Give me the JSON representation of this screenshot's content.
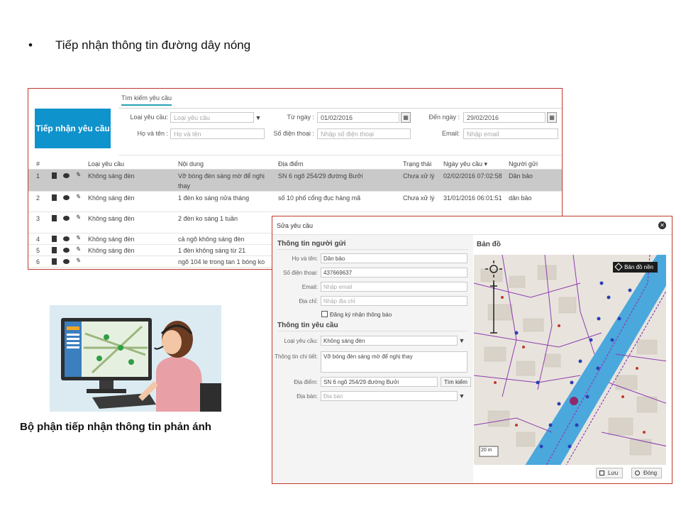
{
  "heading": {
    "bullet": "•",
    "text": "Tiếp nhận thông tin đường dây nóng"
  },
  "list_panel": {
    "tab": "Tìm kiếm yêu cầu",
    "big_button": "Tiếp nhận yêu cầu",
    "filters": {
      "request_type_label": "Loại yêu cầu:",
      "request_type_placeholder": "Loại yêu cầu",
      "from_date_label": "Từ ngày :",
      "from_date_value": "01/02/2016",
      "to_date_label": "Đến ngày :",
      "to_date_value": "29/02/2016",
      "name_label": "Họ và tên :",
      "name_placeholder": "Họ và tên",
      "phone_label": "Số điện thoại :",
      "phone_placeholder": "Nhập số điện thoại",
      "email_label": "Email:",
      "email_placeholder": "Nhập email"
    },
    "columns": [
      "#",
      "Loại yêu cầu",
      "Nội dung",
      "Địa điểm",
      "Trạng thái",
      "Ngày yêu cầu ▾",
      "Người gửi"
    ],
    "rows": [
      {
        "num": "1",
        "type": "Không sáng đèn",
        "content": "Vỡ bóng đèn sáng mờ để nghị",
        "content2": "thay",
        "place": "SN 6 ngõ 254/29 đường Bưởi",
        "status": "Chưa xử lý",
        "date": "02/02/2016 07:02:58",
        "sender": "Dân bảo"
      },
      {
        "num": "2",
        "type": "Không sáng đèn",
        "content": "1 đèn ko sáng nửa tháng",
        "content2": "",
        "place": "số 10 phố cổng đục hàng mã",
        "status": "Chưa xử lý",
        "date": "31/01/2016 06:01:51",
        "sender": "dân bảo"
      },
      {
        "num": "3",
        "type": "Không sáng đèn",
        "content": "2 đèn ko sáng 1 tuần",
        "content2": "",
        "place": "",
        "status": "",
        "date": "",
        "sender": ""
      },
      {
        "num": "4",
        "type": "Không sáng đèn",
        "content": "cả ngõ không sáng đèn",
        "content2": "",
        "place": "",
        "status": "",
        "date": "",
        "sender": ""
      },
      {
        "num": "5",
        "type": "Không sáng đèn",
        "content": "1 đèn không sáng từ 21",
        "content2": "",
        "place": "",
        "status": "",
        "date": "",
        "sender": ""
      },
      {
        "num": "6",
        "type": "",
        "content": "ngõ 104 le trong tan 1 bóng ko",
        "content2": "",
        "place": "",
        "status": "",
        "date": "",
        "sender": ""
      }
    ]
  },
  "caption": "Bộ phận tiếp nhận thông tin phản ánh",
  "edit_dialog": {
    "title": "Sửa yêu cầu",
    "sender_section": "Thông tin người gửi",
    "name_label": "Họ và tên:",
    "name_value": "Dân bảo",
    "phone_label": "Số điện thoại:",
    "phone_value": "437669637",
    "email_label": "Email:",
    "email_placeholder": "Nhập email",
    "address_label": "Địa chỉ:",
    "address_placeholder": "Nhập địa chỉ",
    "notify_label": "Đăng ký nhận thông báo",
    "request_section": "Thông tin yêu cầu",
    "type_label": "Loại yêu cầu:",
    "type_value": "Không sáng đèn",
    "detail_label": "Thông tin chi tiết:",
    "detail_value": "Vỡ bóng đèn sáng mờ để nghị thay",
    "place_label": "Địa điểm:",
    "place_value": "SN 6 ngõ 254/29 đường Bưởi",
    "search_button": "Tìm kiếm",
    "area_label": "Địa bàn:",
    "area_placeholder": "Địa bàn",
    "map_title": "Bản đồ",
    "basemap_button": "Bản đồ nền",
    "scale_label": "20 m",
    "save_button": "Lưu",
    "close_button": "Đóng"
  },
  "colors": {
    "accent": "#0f93cc",
    "border_red": "#c0392b",
    "river": "#4aa8dc",
    "roads": "#8e3bb0",
    "selected_row": "#c9c9c9"
  }
}
